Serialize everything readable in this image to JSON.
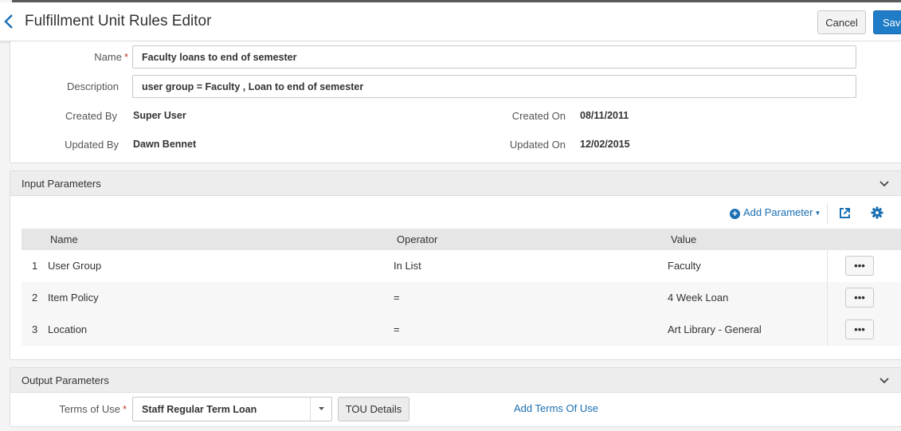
{
  "header": {
    "title": "Fulfillment Unit Rules Editor",
    "cancel_label": "Cancel",
    "save_label": "Save"
  },
  "general": {
    "name_label": "Name",
    "name_value": "Faculty loans to end of semester",
    "description_label": "Description",
    "description_value": "user group = Faculty , Loan to end of semester",
    "created_by_label": "Created By",
    "created_by_value": "Super User",
    "created_on_label": "Created On",
    "created_on_value": "08/11/2011",
    "updated_by_label": "Updated By",
    "updated_by_value": "Dawn Bennet",
    "updated_on_label": "Updated On",
    "updated_on_value": "12/02/2015"
  },
  "input_parameters": {
    "title": "Input Parameters",
    "add_parameter_label": "Add Parameter",
    "columns": [
      "Name",
      "Operator",
      "Value"
    ],
    "rows": [
      {
        "index": "1",
        "name": "User Group",
        "operator": "In List",
        "value": "Faculty",
        "action": "•••"
      },
      {
        "index": "2",
        "name": "Item Policy",
        "operator": "=",
        "value": "4 Week Loan",
        "action": "•••"
      },
      {
        "index": "3",
        "name": "Location",
        "operator": "=",
        "value": "Art Library - General",
        "action": "•••"
      }
    ]
  },
  "output_parameters": {
    "title": "Output Parameters",
    "terms_of_use_label": "Terms of Use",
    "terms_of_use_value": "Staff Regular Term Loan",
    "tou_details_label": "TOU Details",
    "add_terms_label": "Add Terms Of Use"
  },
  "colors": {
    "accent": "#1a6fb3",
    "save_button": "#1f7cc6",
    "required": "#c0392b"
  },
  "icons": [
    "chevron-left-icon",
    "chevron-down-icon",
    "plus-circle-icon",
    "export-icon",
    "gear-icon",
    "caret-down-icon"
  ]
}
